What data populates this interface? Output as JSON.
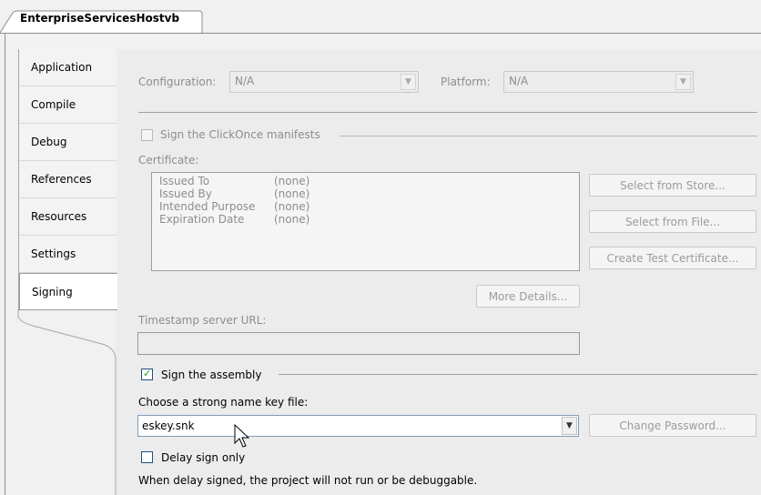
{
  "document_tab": {
    "title": "EnterpriseServicesHostvb"
  },
  "nav_tabs": [
    {
      "label": "Application"
    },
    {
      "label": "Compile"
    },
    {
      "label": "Debug"
    },
    {
      "label": "References"
    },
    {
      "label": "Resources"
    },
    {
      "label": "Settings"
    },
    {
      "label": "Signing",
      "active": true
    }
  ],
  "config_bar": {
    "configuration_label": "Configuration:",
    "configuration_value": "N/A",
    "platform_label": "Platform:",
    "platform_value": "N/A"
  },
  "clickonce": {
    "sign_manifests_label": "Sign the ClickOnce manifests",
    "sign_manifests_checked": false,
    "certificate_label": "Certificate:",
    "fields": [
      {
        "name": "Issued To",
        "value": "(none)"
      },
      {
        "name": "Issued By",
        "value": "(none)"
      },
      {
        "name": "Intended Purpose",
        "value": "(none)"
      },
      {
        "name": "Expiration Date",
        "value": "(none)"
      }
    ],
    "select_from_store": "Select from Store...",
    "select_from_file": "Select from File...",
    "create_test_certificate": "Create Test Certificate...",
    "more_details": "More Details...",
    "timestamp_label": "Timestamp server URL:",
    "timestamp_value": ""
  },
  "assembly": {
    "sign_assembly_label": "Sign the assembly",
    "sign_assembly_checked": true,
    "key_file_label": "Choose a strong name key file:",
    "key_file_value": "eskey.snk",
    "change_password": "Change Password...",
    "delay_sign_label": "Delay sign only",
    "delay_sign_checked": false,
    "delay_sign_note": "When delay signed, the project will not run or be debuggable."
  },
  "colors": {
    "disabled_text": "#8d8d8d",
    "check_mark": "#21a121",
    "panel_bg": "#ececec"
  },
  "icons": {
    "combo_arrow": "chevron-down-icon",
    "mouse_cursor": "arrow-cursor-icon"
  }
}
